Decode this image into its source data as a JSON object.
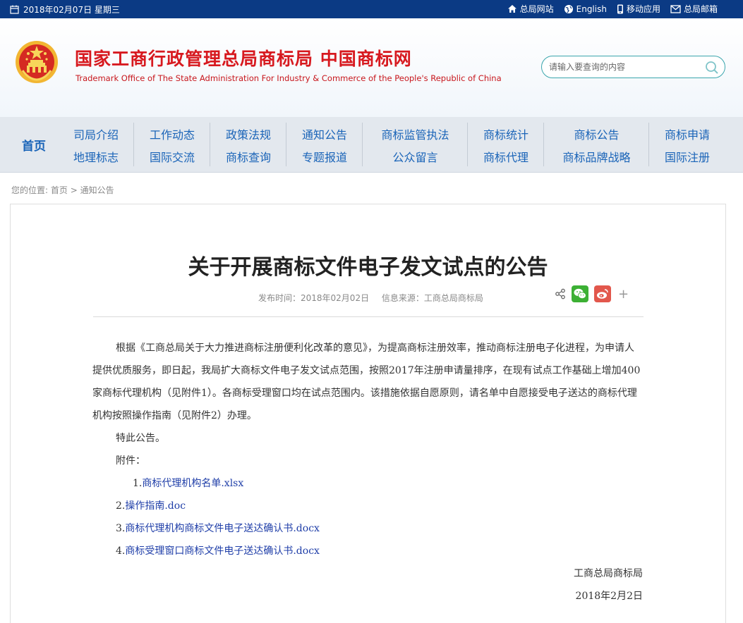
{
  "topbar": {
    "date": "2018年02月07日 星期三",
    "links": [
      {
        "label": "总局网站",
        "icon": "home-icon"
      },
      {
        "label": "English",
        "icon": "globe-icon"
      },
      {
        "label": "移动应用",
        "icon": "mobile-icon"
      },
      {
        "label": "总局邮箱",
        "icon": "mail-icon"
      }
    ]
  },
  "header": {
    "title": "国家工商行政管理总局商标局 中国商标网",
    "subtitle": "Trademark Office of The State Administration For Industry & Commerce of the People's Republic of China",
    "search_placeholder": "请输入要查询的内容"
  },
  "nav": {
    "home": "首页",
    "columns": [
      [
        "司局介绍",
        "地理标志"
      ],
      [
        "工作动态",
        "国际交流"
      ],
      [
        "政策法规",
        "商标查询"
      ],
      [
        "通知公告",
        "专题报道"
      ],
      [
        "商标监管执法",
        "公众留言"
      ],
      [
        "商标统计",
        "商标代理"
      ],
      [
        "商标公告",
        "商标品牌战略"
      ],
      [
        "商标申请",
        "国际注册"
      ]
    ]
  },
  "breadcrumb": {
    "prefix": "您的位置:",
    "home": "首页",
    "sep": ">",
    "current": "通知公告"
  },
  "article": {
    "title": "关于开展商标文件电子发文试点的公告",
    "publish_time": "发布时间：2018年02月02日",
    "source": "信息来源：工商总局商标局",
    "paragraph": "根据《工商总局关于大力推进商标注册便利化改革的意见》，为提高商标注册效率，推动商标注册电子化进程，为申请人提供优质服务，即日起，我局扩大商标文件电子发文试点范围，按照2017年注册申请量排序，在现有试点工作基础上增加400家商标代理机构（见附件1）。各商标受理窗口均在试点范围内。该措施依据自愿原则，请名单中自愿接受电子送达的商标代理机构按照操作指南（见附件2）办理。",
    "closing": "特此公告。",
    "attachments_label": "附件：",
    "attachments": [
      {
        "num": "1.",
        "name": "商标代理机构名单.xlsx"
      },
      {
        "num": "2.",
        "name": "操作指南.doc"
      },
      {
        "num": "3.",
        "name": "商标代理机构商标文件电子送达确认书.docx"
      },
      {
        "num": "4.",
        "name": "商标受理窗口商标文件电子送达确认书.docx"
      }
    ],
    "signature": "工商总局商标局",
    "sign_date": "2018年2月2日"
  },
  "colors": {
    "topbar": "#0b3a84",
    "title_red": "#d7191f",
    "nav_link": "#1a64b8",
    "nav_bg": "#e3e8ee",
    "link_blue": "#1f3ea8",
    "wechat": "#3cb034",
    "weibo": "#e2574c"
  }
}
